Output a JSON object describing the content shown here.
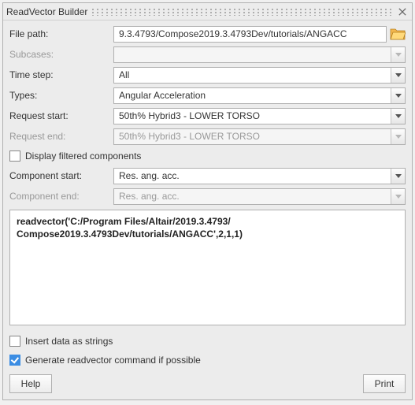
{
  "window": {
    "title": "ReadVector Builder"
  },
  "labels": {
    "file_path": "File path:",
    "subcases": "Subcases:",
    "time_step": "Time step:",
    "types": "Types:",
    "request_start": "Request start:",
    "request_end": "Request end:",
    "display_filtered": "Display filtered components",
    "component_start": "Component start:",
    "component_end": "Component end:",
    "insert_strings": "Insert data as strings",
    "generate_cmd": "Generate readvector command if possible"
  },
  "fields": {
    "file_path": "9.3.4793/Compose2019.3.4793Dev/tutorials/ANGACC",
    "subcases": "",
    "time_step": "All",
    "types": "Angular Acceleration",
    "request_start": "50th% Hybrid3   - LOWER TORSO",
    "request_end": "50th% Hybrid3   - LOWER TORSO",
    "component_start": "Res. ang. acc.",
    "component_end": "Res. ang. acc."
  },
  "checkboxes": {
    "display_filtered": false,
    "insert_strings": false,
    "generate_cmd": true
  },
  "output": {
    "line1": "readvector('C:/Program Files/Altair/2019.3.4793/",
    "line2": "Compose2019.3.4793Dev/tutorials/ANGACC',2,1,1)"
  },
  "buttons": {
    "help": "Help",
    "print": "Print"
  }
}
